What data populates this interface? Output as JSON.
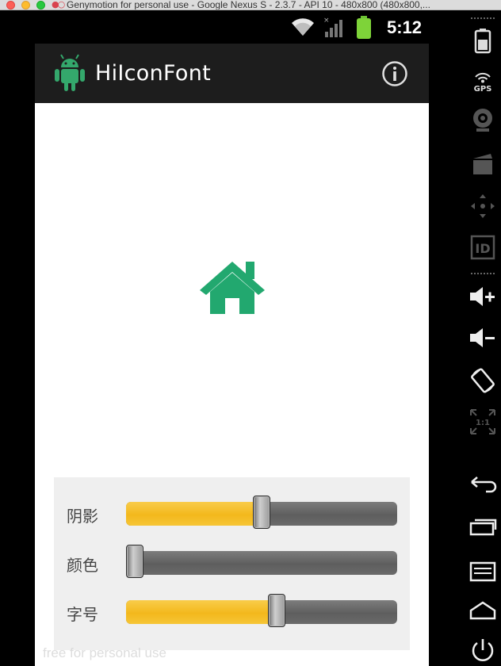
{
  "window": {
    "title": "Genymotion for personal use - Google Nexus S - 2.3.7 - API 10 - 480x800 (480x800,..."
  },
  "statusbar": {
    "time": "5:12"
  },
  "app": {
    "title": "HiIconFont",
    "preview_icon": "home-icon",
    "icon_color": "#22a86f"
  },
  "sliders": [
    {
      "label": "阴影",
      "value": 0.5
    },
    {
      "label": "颜色",
      "value": 0.0
    },
    {
      "label": "字号",
      "value": 0.56
    }
  ],
  "watermark": "free for personal use",
  "colors": {
    "accent": "#22a86f",
    "slider_fill": "#f5bd25",
    "actionbar": "#1d1d1d"
  },
  "side_toolbar": [
    "battery-icon",
    "gps-icon",
    "camera-icon",
    "video-icon",
    "dpad-icon",
    "id-icon",
    "volume-up-icon",
    "volume-down-icon",
    "rotate-icon",
    "scale-icon",
    "back-icon",
    "recent-apps-icon",
    "menu-icon",
    "home-button-icon",
    "power-icon"
  ]
}
